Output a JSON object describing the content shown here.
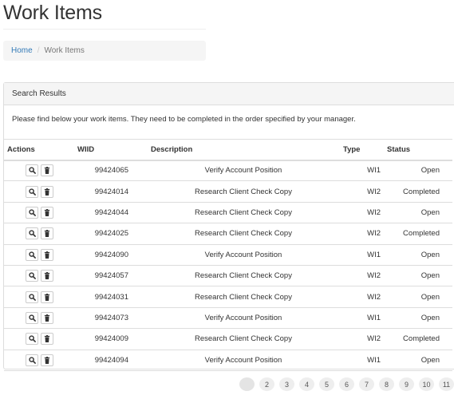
{
  "page": {
    "title": "Work Items"
  },
  "breadcrumb": {
    "home": "Home",
    "separator": "/",
    "current": "Work Items"
  },
  "panel": {
    "heading": "Search Results",
    "intro": "Please find below your work items. They need to be completed in the order specified by your manager."
  },
  "table": {
    "headers": {
      "actions": "Actions",
      "wiid": "WIID",
      "description": "Description",
      "type": "Type",
      "status": "Status"
    },
    "rows": [
      {
        "wiid": "99424065",
        "description": "Verify Account Position",
        "type": "WI1",
        "status": "Open"
      },
      {
        "wiid": "99424014",
        "description": "Research Client Check Copy",
        "type": "WI2",
        "status": "Completed"
      },
      {
        "wiid": "99424044",
        "description": "Research Client Check Copy",
        "type": "WI2",
        "status": "Open"
      },
      {
        "wiid": "99424025",
        "description": "Research Client Check Copy",
        "type": "WI2",
        "status": "Completed"
      },
      {
        "wiid": "99424090",
        "description": "Verify Account Position",
        "type": "WI1",
        "status": "Open"
      },
      {
        "wiid": "99424057",
        "description": "Research Client Check Copy",
        "type": "WI2",
        "status": "Open"
      },
      {
        "wiid": "99424031",
        "description": "Research Client Check Copy",
        "type": "WI2",
        "status": "Open"
      },
      {
        "wiid": "99424073",
        "description": "Verify Account Position",
        "type": "WI1",
        "status": "Open"
      },
      {
        "wiid": "99424009",
        "description": "Research Client Check Copy",
        "type": "WI2",
        "status": "Completed"
      },
      {
        "wiid": "99424094",
        "description": "Verify Account Position",
        "type": "WI1",
        "status": "Open"
      }
    ],
    "row_action_icons": [
      "search-icon",
      "trash-icon"
    ]
  },
  "pagination": {
    "pages": [
      "1",
      "2",
      "3",
      "4",
      "5",
      "6",
      "7",
      "8",
      "9",
      "10",
      "11"
    ],
    "current": "1"
  },
  "colors": {
    "link": "#337ab7",
    "panel_heading_bg": "#f5f5f5",
    "border": "#dddddd"
  }
}
